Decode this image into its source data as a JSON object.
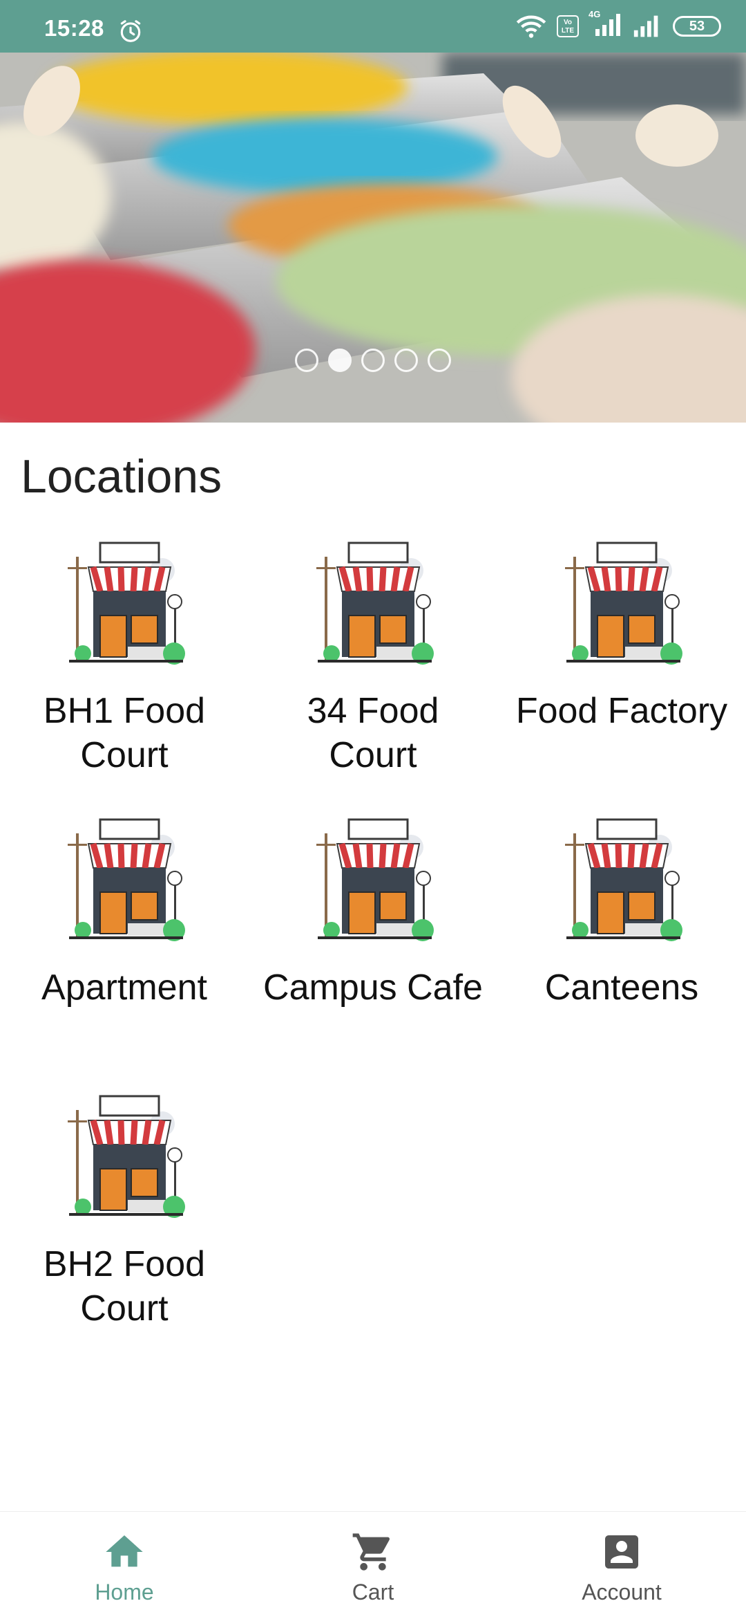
{
  "status_bar": {
    "time": "15:28",
    "battery": "53",
    "volte_label": "Vo LTE",
    "network": "4G",
    "icons": [
      "alarm-icon",
      "wifi-icon",
      "volte-icon",
      "signal-icon",
      "signal-icon",
      "battery-icon"
    ]
  },
  "banner": {
    "image": "ice-cream-display-photo",
    "slide_count": 5,
    "active_slide": 2
  },
  "locations": {
    "title": "Locations",
    "items": [
      {
        "label": "BH1 Food Court",
        "icon": "storefront-icon"
      },
      {
        "label": "34 Food Court",
        "icon": "storefront-icon"
      },
      {
        "label": "Food Factory",
        "icon": "storefront-icon"
      },
      {
        "label": "Apartment",
        "icon": "storefront-icon"
      },
      {
        "label": "Campus Cafe",
        "icon": "storefront-icon"
      },
      {
        "label": "Canteens",
        "icon": "storefront-icon"
      },
      {
        "label": "BH2 Food Court",
        "icon": "storefront-icon"
      }
    ]
  },
  "bottom_nav": {
    "items": [
      {
        "label": "Home",
        "icon": "home-icon",
        "active": true
      },
      {
        "label": "Cart",
        "icon": "cart-icon",
        "active": false
      },
      {
        "label": "Account",
        "icon": "account-icon",
        "active": false
      }
    ]
  },
  "colors": {
    "accent": "#5e9f91",
    "text": "#111111",
    "inactive_nav": "#555555"
  }
}
